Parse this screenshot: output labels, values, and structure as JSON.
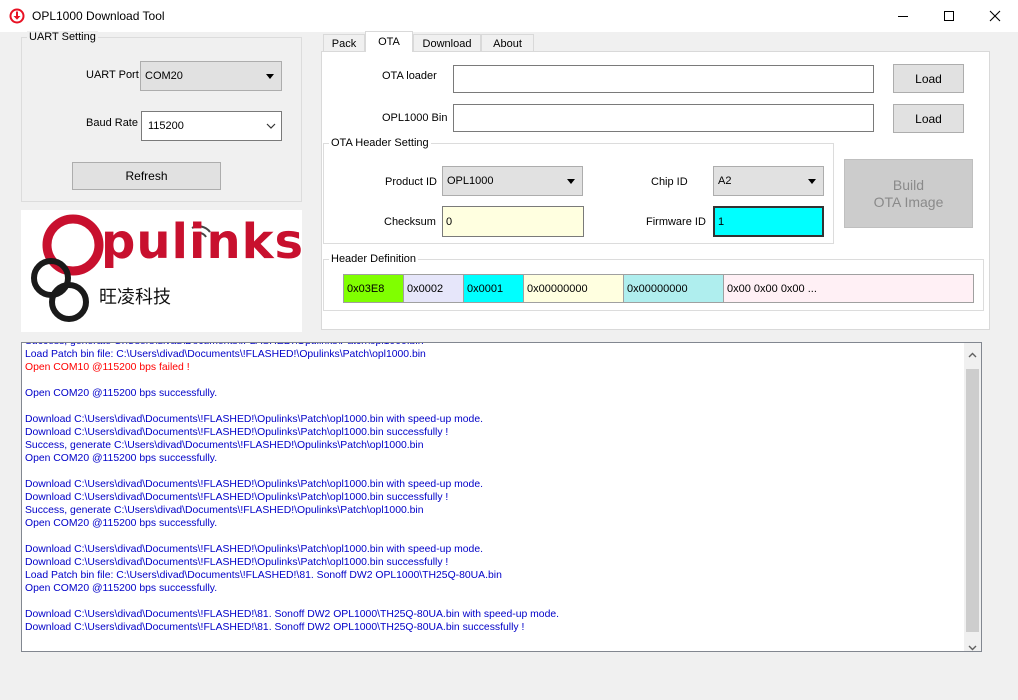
{
  "window": {
    "title": "OPL1000 Download Tool",
    "icon": "download-circle-icon",
    "accent": "#e81123"
  },
  "uart": {
    "group_title": "UART Setting",
    "port_label": "UART Port",
    "port_value": "COM20",
    "baud_label": "Baud Rate",
    "baud_value": "115200",
    "refresh_label": "Refresh"
  },
  "logo": {
    "text_main": "pulinks",
    "text_sub": "旺凌科技",
    "brand_color": "#c8102e"
  },
  "tabs": [
    {
      "label": "Pack"
    },
    {
      "label": "OTA"
    },
    {
      "label": "Download"
    },
    {
      "label": "About"
    }
  ],
  "ota": {
    "loader_label": "OTA loader",
    "loader_value": "",
    "loader_button": "Load",
    "bin_label": "OPL1000 Bin",
    "bin_value": "",
    "bin_button": "Load",
    "header_group_title": "OTA Header Setting",
    "product_label": "Product ID",
    "product_value": "OPL1000",
    "chip_label": "Chip ID",
    "chip_value": "A2",
    "checksum_label": "Checksum",
    "checksum_value": "0",
    "firmware_label": "Firmware ID",
    "firmware_value": "1",
    "build_label_1": "Build",
    "build_label_2": "OTA Image",
    "header_def_title": "Header Definition",
    "header_cells": [
      {
        "text": "0x03E8",
        "color": "#80ff00"
      },
      {
        "text": "0x0002",
        "color": "#e6e6fa"
      },
      {
        "text": "0x0001",
        "color": "#00ffff"
      },
      {
        "text": "0x00000000",
        "color": "#ffffe0"
      },
      {
        "text": "0x00000000",
        "color": "#afeeee"
      },
      {
        "text": "0x00 0x00 0x00 ...",
        "color": "#fff0f5"
      }
    ]
  },
  "log": {
    "colors": {
      "info": "#0000c8",
      "error": "#ff0000"
    },
    "lines": [
      {
        "text": "Success, generate C:\\Users\\divad\\Documents\\!FLASHED!\\Opulinks\\Patch\\opl1000.bin",
        "type": "info"
      },
      {
        "text": "Load Patch bin file: C:\\Users\\divad\\Documents\\!FLASHED!\\Opulinks\\Patch\\opl1000.bin",
        "type": "info"
      },
      {
        "text": "Open COM10 @115200 bps failed !",
        "type": "error"
      },
      {
        "text": "",
        "type": "info"
      },
      {
        "text": "Open COM20 @115200 bps successfully.",
        "type": "info"
      },
      {
        "text": "",
        "type": "info"
      },
      {
        "text": "Download C:\\Users\\divad\\Documents\\!FLASHED!\\Opulinks\\Patch\\opl1000.bin with speed-up mode.",
        "type": "info"
      },
      {
        "text": "Download C:\\Users\\divad\\Documents\\!FLASHED!\\Opulinks\\Patch\\opl1000.bin successfully !",
        "type": "info"
      },
      {
        "text": "Success, generate C:\\Users\\divad\\Documents\\!FLASHED!\\Opulinks\\Patch\\opl1000.bin",
        "type": "info"
      },
      {
        "text": "Open COM20 @115200 bps successfully.",
        "type": "info"
      },
      {
        "text": "",
        "type": "info"
      },
      {
        "text": "Download C:\\Users\\divad\\Documents\\!FLASHED!\\Opulinks\\Patch\\opl1000.bin with speed-up mode.",
        "type": "info"
      },
      {
        "text": "Download C:\\Users\\divad\\Documents\\!FLASHED!\\Opulinks\\Patch\\opl1000.bin successfully !",
        "type": "info"
      },
      {
        "text": "Success, generate C:\\Users\\divad\\Documents\\!FLASHED!\\Opulinks\\Patch\\opl1000.bin",
        "type": "info"
      },
      {
        "text": "Open COM20 @115200 bps successfully.",
        "type": "info"
      },
      {
        "text": "",
        "type": "info"
      },
      {
        "text": "Download C:\\Users\\divad\\Documents\\!FLASHED!\\Opulinks\\Patch\\opl1000.bin with speed-up mode.",
        "type": "info"
      },
      {
        "text": "Download C:\\Users\\divad\\Documents\\!FLASHED!\\Opulinks\\Patch\\opl1000.bin successfully !",
        "type": "info"
      },
      {
        "text": "Load Patch bin file: C:\\Users\\divad\\Documents\\!FLASHED!\\81. Sonoff DW2 OPL1000\\TH25Q-80UA.bin",
        "type": "info"
      },
      {
        "text": "Open COM20 @115200 bps successfully.",
        "type": "info"
      },
      {
        "text": "",
        "type": "info"
      },
      {
        "text": "Download C:\\Users\\divad\\Documents\\!FLASHED!\\81. Sonoff DW2 OPL1000\\TH25Q-80UA.bin with speed-up mode.",
        "type": "info"
      },
      {
        "text": "Download C:\\Users\\divad\\Documents\\!FLASHED!\\81. Sonoff DW2 OPL1000\\TH25Q-80UA.bin successfully !",
        "type": "info"
      }
    ]
  }
}
